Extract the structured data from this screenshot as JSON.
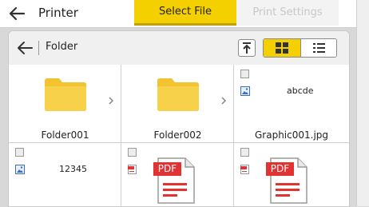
{
  "header": {
    "title": "Printer",
    "tabs": [
      {
        "label": "Select File",
        "active": true
      },
      {
        "label": "Print Settings",
        "active": false
      }
    ]
  },
  "toolbar": {
    "folder_label": "Folder",
    "view_mode": "grid"
  },
  "files": [
    {
      "name": "Folder001",
      "type": "folder"
    },
    {
      "name": "Folder002",
      "type": "folder"
    },
    {
      "name": "Graphic001.jpg",
      "type": "image",
      "preview_text": "abcde"
    },
    {
      "name": "",
      "type": "image",
      "preview_text": "12345"
    },
    {
      "name": "",
      "type": "pdf",
      "badge": "PDF"
    },
    {
      "name": "",
      "type": "pdf",
      "badge": "PDF"
    }
  ],
  "colors": {
    "accent": "#f5d000",
    "folder": "#f5cc3a",
    "pdf_red": "#e23232"
  }
}
